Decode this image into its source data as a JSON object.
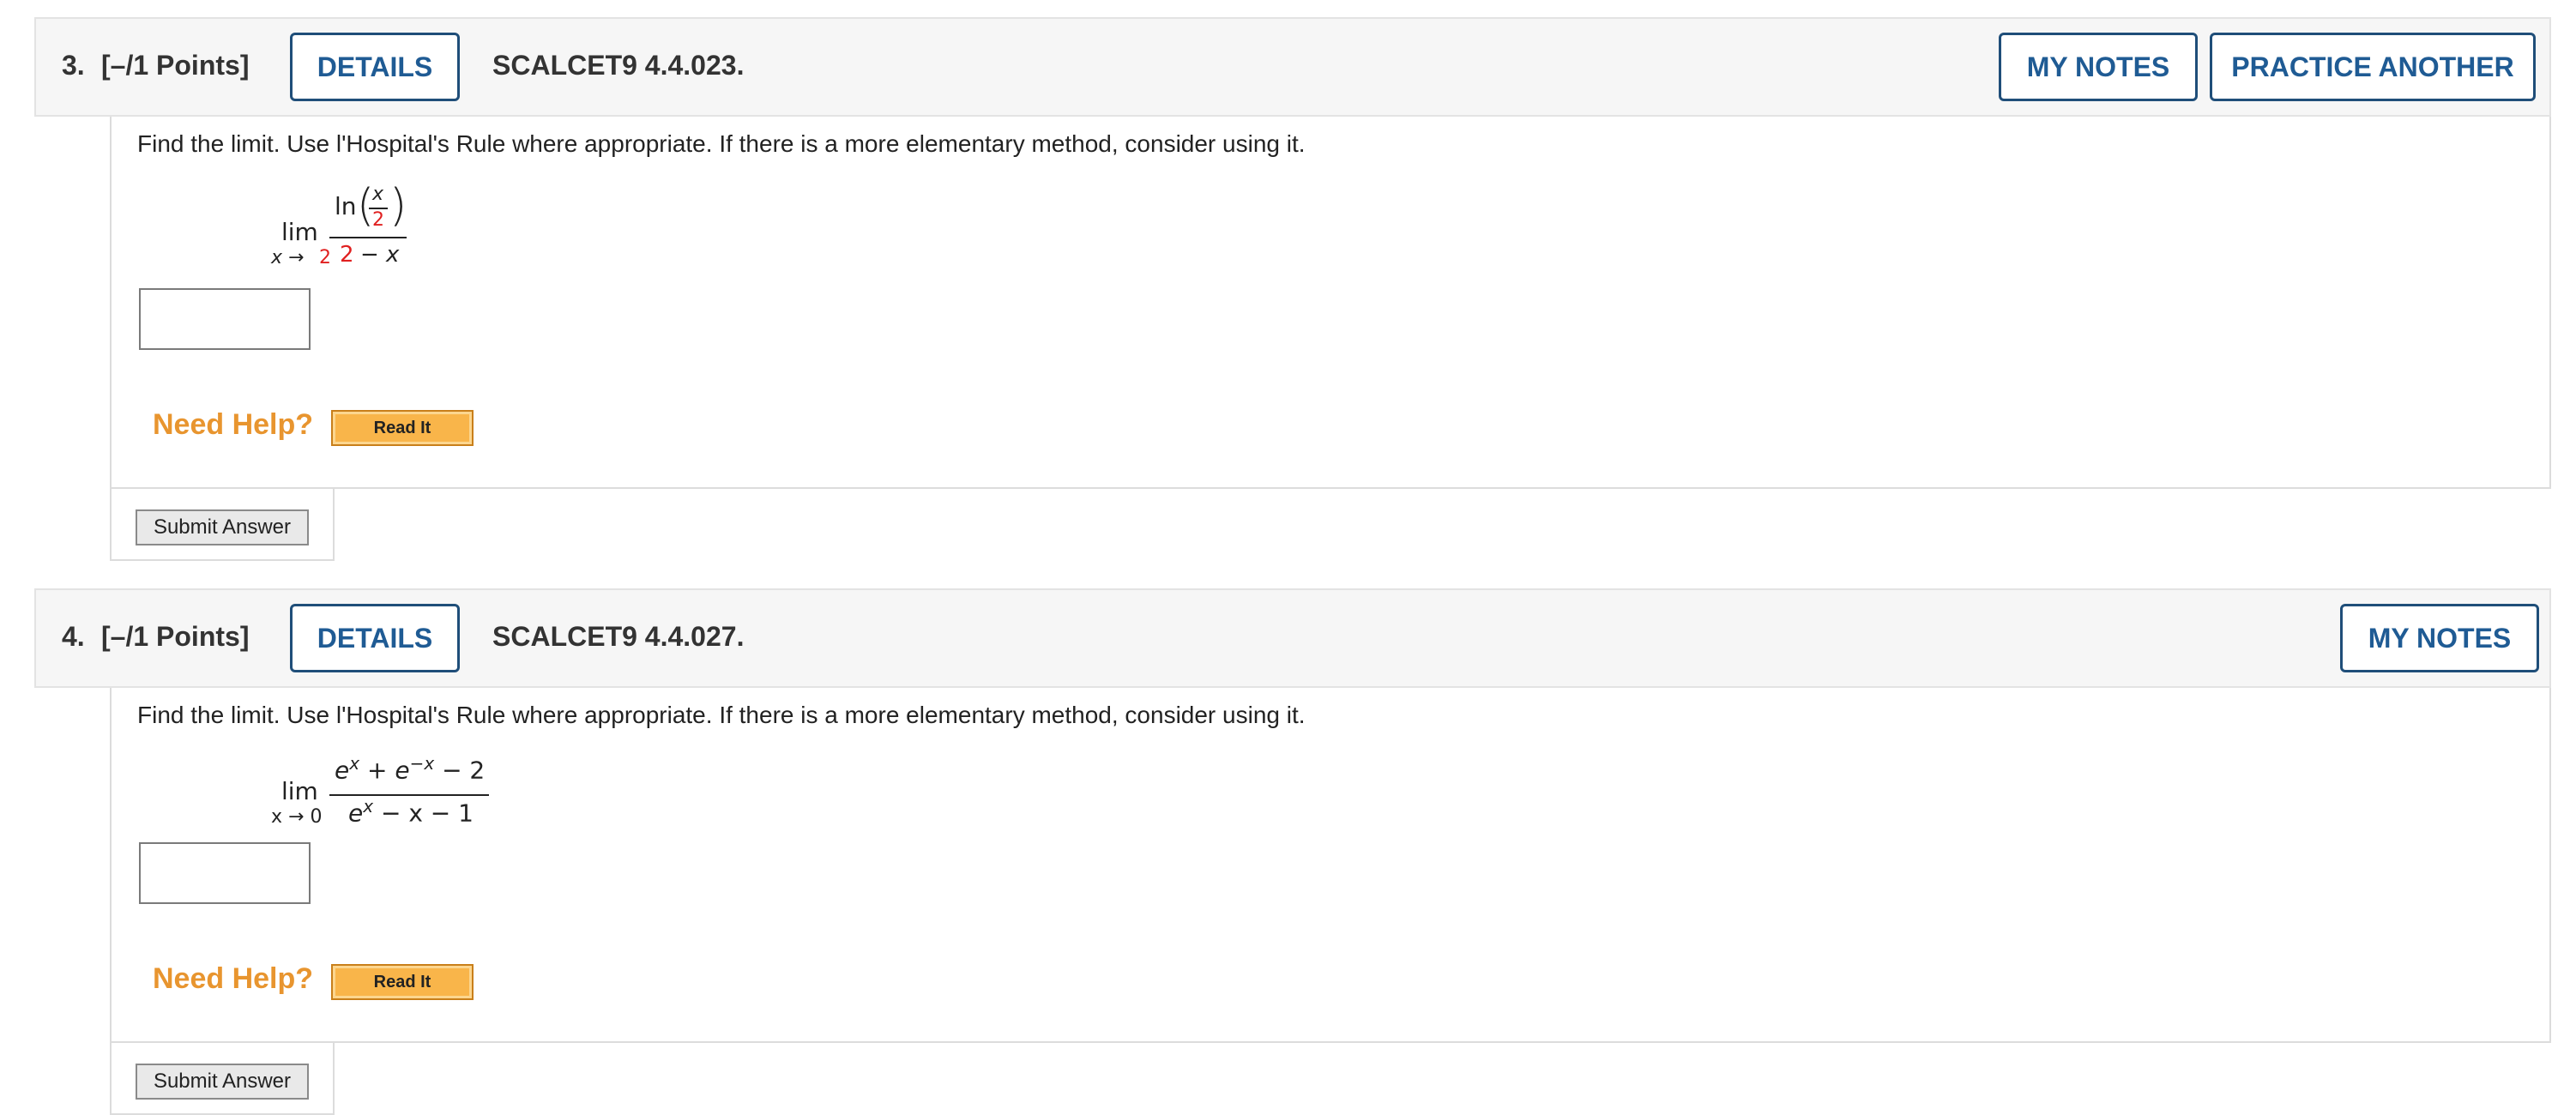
{
  "questions": [
    {
      "number": "3.",
      "points": "[–/1 Points]",
      "details_label": "DETAILS",
      "code": "SCALCET9 4.4.023.",
      "my_notes_label": "MY NOTES",
      "practice_label": "PRACTICE ANOTHER",
      "prompt": "Find the limit. Use l'Hospital's Rule where appropriate. If there is a more elementary method, consider using it.",
      "limit": {
        "lim": "lim",
        "approach_var": "x →",
        "approach_val": "2",
        "numerator_fn": "ln",
        "numerator_inner_num": "x",
        "numerator_inner_den": "2",
        "denominator_lead": "2",
        "denominator_rest": "− x"
      },
      "answer_value": "",
      "need_help": "Need Help?",
      "read_it": "Read It",
      "submit": "Submit Answer"
    },
    {
      "number": "4.",
      "points": "[–/1 Points]",
      "details_label": "DETAILS",
      "code": "SCALCET9 4.4.027.",
      "my_notes_label": "MY NOTES",
      "prompt": "Find the limit. Use l'Hospital's Rule where appropriate. If there is a more elementary method, consider using it.",
      "limit": {
        "lim": "lim",
        "approach": "x → 0",
        "num_e1": "e",
        "num_exp1": "x",
        "num_plus": " + e",
        "num_exp2": "−x",
        "num_rest": " − 2",
        "den_e": "e",
        "den_exp": "x",
        "den_rest": " − x − 1"
      },
      "answer_value": "",
      "need_help": "Need Help?",
      "read_it": "Read It",
      "submit": "Submit Answer"
    }
  ],
  "colors": {
    "button_text": "#1f5b94",
    "button_border": "#1f4e79",
    "need_help": "#e8952f",
    "approach_highlight": "#e02020"
  }
}
